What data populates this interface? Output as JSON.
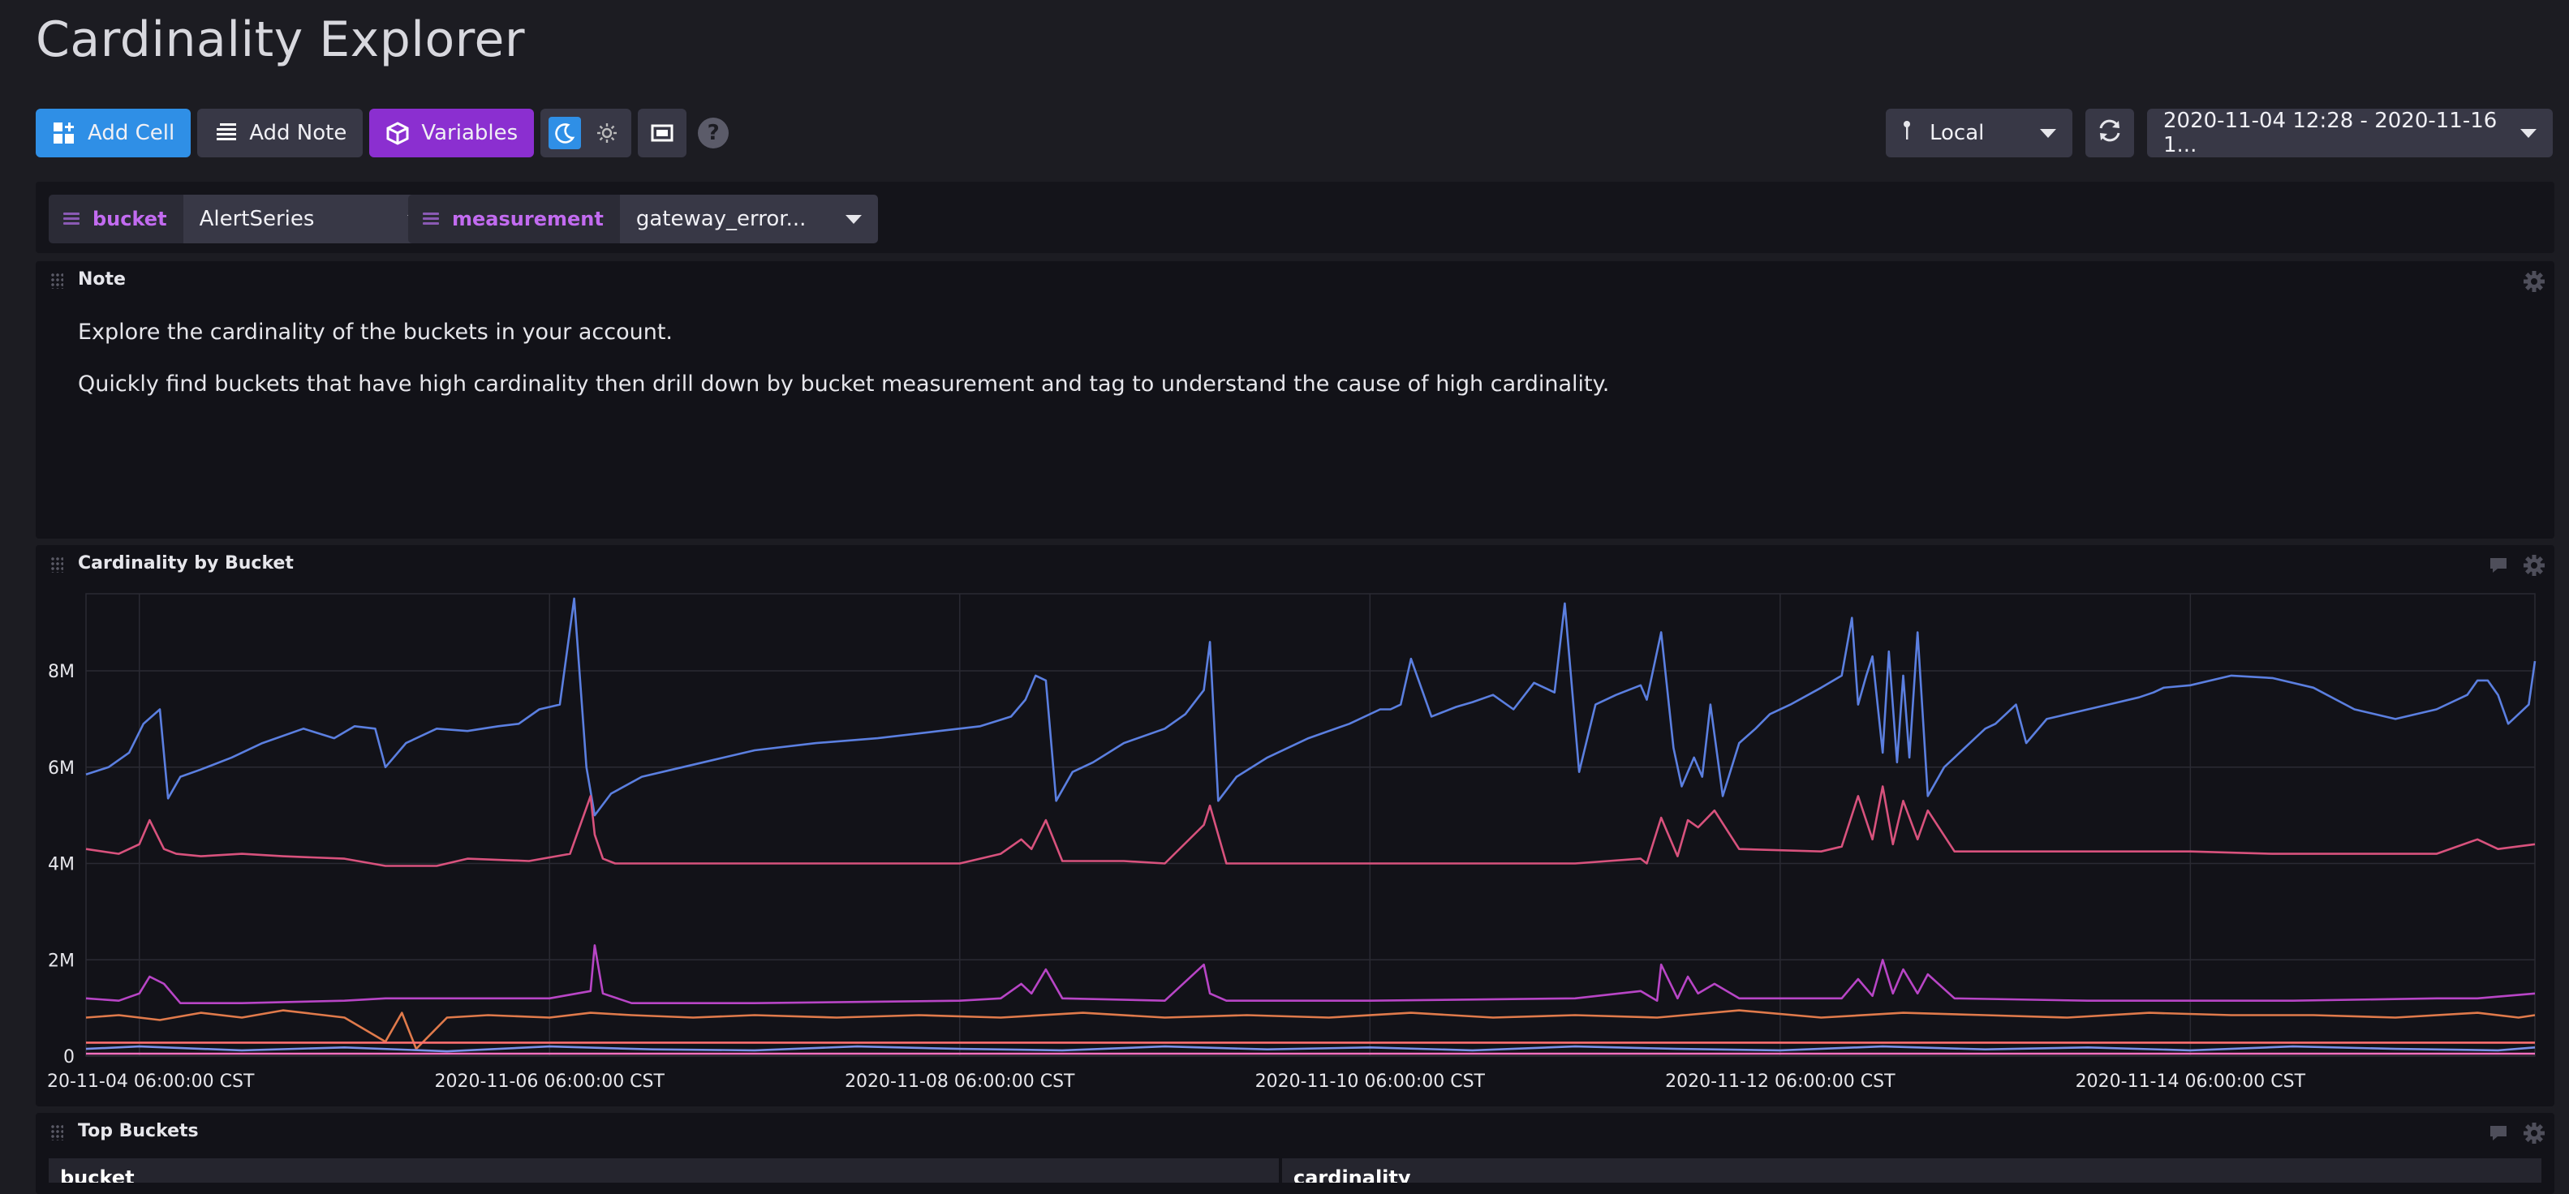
{
  "page_title": "Cardinality Explorer",
  "toolbar": {
    "add_cell": "Add Cell",
    "add_note": "Add Note",
    "variables": "Variables"
  },
  "timezone": "Local",
  "time_range": "2020-11-04 12:28 - 2020-11-16 1...",
  "variables": [
    {
      "name": "bucket",
      "value": "AlertSeries"
    },
    {
      "name": "measurement",
      "value": "gateway_error..."
    }
  ],
  "note_cell": {
    "title": "Note",
    "paragraphs": [
      "Explore the cardinality of the buckets in your account.",
      "Quickly find buckets that have high cardinality then drill down by bucket measurement and tag to understand the cause of high cardinality."
    ]
  },
  "chart_cell": {
    "title": "Cardinality by Bucket"
  },
  "top_buckets": {
    "title": "Top Buckets",
    "columns": [
      "bucket",
      "cardinality"
    ]
  },
  "colors": {
    "accent": "#2f8fe6",
    "variables_button": "#8b2fd0",
    "series_blue": "#5b7fe0",
    "series_pink": "#d8527d",
    "series_purple": "#b845c6",
    "series_orange": "#e07a4b",
    "series_coral": "#ff6f6f"
  },
  "chart_data": {
    "type": "line",
    "title": "",
    "xlabel": "",
    "ylabel": "",
    "x_ticks": [
      "20-11-04 06:00:00 CST",
      "2020-11-06 06:00:00 CST",
      "2020-11-08 06:00:00 CST",
      "2020-11-10 06:00:00 CST",
      "2020-11-12 06:00:00 CST",
      "2020-11-14 06:00:00 CST"
    ],
    "x_tick_dates": [
      3.0,
      5.0,
      7.0,
      9.0,
      11.0,
      13.0
    ],
    "y_ticks": [
      "0",
      "2M",
      "4M",
      "6M",
      "8M"
    ],
    "y_tick_values": [
      0,
      2,
      4,
      6,
      8
    ],
    "ylim": [
      0,
      9.6
    ],
    "xlim": [
      2.74,
      14.68
    ],
    "grid": true,
    "legend": "none",
    "series": [
      {
        "color": "#5b7fe0",
        "x": [
          2.74,
          2.85,
          2.95,
          3.02,
          3.1,
          3.14,
          3.2,
          3.3,
          3.45,
          3.6,
          3.8,
          3.95,
          4.05,
          4.15,
          4.2,
          4.3,
          4.45,
          4.6,
          4.75,
          4.85,
          4.95,
          5.05,
          5.12,
          5.18,
          5.22,
          5.3,
          5.45,
          5.6,
          5.8,
          6.0,
          6.3,
          6.6,
          6.9,
          7.1,
          7.25,
          7.32,
          7.37,
          7.42,
          7.47,
          7.55,
          7.65,
          7.8,
          8.0,
          8.1,
          8.19,
          8.22,
          8.26,
          8.35,
          8.5,
          8.7,
          8.9,
          9.05,
          9.1,
          9.15,
          9.2,
          9.3,
          9.42,
          9.5,
          9.6,
          9.7,
          9.8,
          9.9,
          9.95,
          10.02,
          10.1,
          10.2,
          10.32,
          10.35,
          10.42,
          10.48,
          10.52,
          10.58,
          10.62,
          10.66,
          10.72,
          10.8,
          10.88,
          10.95,
          11.05,
          11.2,
          11.3,
          11.35,
          11.38,
          11.42,
          11.45,
          11.5,
          11.53,
          11.57,
          11.6,
          11.63,
          11.67,
          11.72,
          11.8,
          11.85,
          11.9,
          11.95,
          12.0,
          12.05,
          12.1,
          12.15,
          12.2,
          12.3,
          12.45,
          12.6,
          12.75,
          12.82,
          12.87,
          13.0,
          13.2,
          13.4,
          13.6,
          13.8,
          14.0,
          14.2,
          14.35,
          14.4,
          14.45,
          14.5,
          14.55,
          14.6,
          14.65,
          14.68
        ],
        "y": [
          5.85,
          6.0,
          6.3,
          6.9,
          7.2,
          5.35,
          5.8,
          5.95,
          6.2,
          6.5,
          6.8,
          6.6,
          6.85,
          6.8,
          6.0,
          6.5,
          6.8,
          6.75,
          6.85,
          6.9,
          7.2,
          7.3,
          9.5,
          6.0,
          5.0,
          5.45,
          5.8,
          5.95,
          6.15,
          6.35,
          6.5,
          6.6,
          6.75,
          6.85,
          7.05,
          7.4,
          7.9,
          7.8,
          5.3,
          5.9,
          6.1,
          6.5,
          6.8,
          7.1,
          7.6,
          8.6,
          5.3,
          5.8,
          6.2,
          6.6,
          6.9,
          7.2,
          7.2,
          7.3,
          8.25,
          7.05,
          7.25,
          7.35,
          7.5,
          7.2,
          7.75,
          7.55,
          9.4,
          5.9,
          7.3,
          7.5,
          7.7,
          7.4,
          8.8,
          6.4,
          5.6,
          6.2,
          5.8,
          7.3,
          5.4,
          6.5,
          6.8,
          7.1,
          7.3,
          7.65,
          7.9,
          9.1,
          7.3,
          7.9,
          8.3,
          6.3,
          8.4,
          6.1,
          7.9,
          6.2,
          8.8,
          5.4,
          6.0,
          6.2,
          6.4,
          6.6,
          6.8,
          6.9,
          7.1,
          7.3,
          6.5,
          7.0,
          7.15,
          7.3,
          7.45,
          7.55,
          7.65,
          7.7,
          7.9,
          7.85,
          7.65,
          7.2,
          7.0,
          7.2,
          7.5,
          7.8,
          7.8,
          7.5,
          6.9,
          7.1,
          7.3,
          8.2
        ]
      },
      {
        "color": "#d8527d",
        "x": [
          2.74,
          2.9,
          3.0,
          3.05,
          3.12,
          3.18,
          3.3,
          3.5,
          3.7,
          4.0,
          4.2,
          4.3,
          4.45,
          4.6,
          4.9,
          5.1,
          5.2,
          5.22,
          5.26,
          5.32,
          5.45,
          5.8,
          6.5,
          7.0,
          7.2,
          7.3,
          7.35,
          7.42,
          7.5,
          7.8,
          8.0,
          8.19,
          8.22,
          8.3,
          8.5,
          9.0,
          9.1,
          9.3,
          9.5,
          10.0,
          10.32,
          10.35,
          10.42,
          10.5,
          10.55,
          10.6,
          10.68,
          10.8,
          11.2,
          11.3,
          11.38,
          11.45,
          11.5,
          11.55,
          11.6,
          11.67,
          11.72,
          11.85,
          12.2,
          12.6,
          13.0,
          13.4,
          13.8,
          14.2,
          14.4,
          14.5,
          14.68
        ],
        "y": [
          4.3,
          4.2,
          4.4,
          4.9,
          4.3,
          4.2,
          4.15,
          4.2,
          4.15,
          4.1,
          3.95,
          3.95,
          3.95,
          4.1,
          4.05,
          4.2,
          5.4,
          4.6,
          4.1,
          4.0,
          4.0,
          4.0,
          4.0,
          4.0,
          4.2,
          4.5,
          4.3,
          4.9,
          4.05,
          4.05,
          4.0,
          4.8,
          5.2,
          4.0,
          4.0,
          4.0,
          4.0,
          4.0,
          4.0,
          4.0,
          4.1,
          4.0,
          4.95,
          4.15,
          4.9,
          4.75,
          5.1,
          4.3,
          4.25,
          4.35,
          5.4,
          4.5,
          5.6,
          4.4,
          5.3,
          4.5,
          5.1,
          4.25,
          4.25,
          4.25,
          4.25,
          4.2,
          4.2,
          4.2,
          4.5,
          4.3,
          4.4
        ]
      },
      {
        "color": "#b845c6",
        "x": [
          2.74,
          2.9,
          3.0,
          3.05,
          3.12,
          3.2,
          3.5,
          4.0,
          4.2,
          4.5,
          5.0,
          5.2,
          5.22,
          5.26,
          5.4,
          6.0,
          7.0,
          7.2,
          7.3,
          7.35,
          7.42,
          7.5,
          8.0,
          8.19,
          8.22,
          8.3,
          9.0,
          10.0,
          10.32,
          10.4,
          10.42,
          10.5,
          10.55,
          10.6,
          10.68,
          10.8,
          11.3,
          11.38,
          11.45,
          11.5,
          11.55,
          11.6,
          11.67,
          11.72,
          11.85,
          12.5,
          13.5,
          14.2,
          14.4,
          14.68
        ],
        "y": [
          1.2,
          1.15,
          1.3,
          1.65,
          1.5,
          1.1,
          1.1,
          1.15,
          1.2,
          1.2,
          1.2,
          1.35,
          2.3,
          1.3,
          1.1,
          1.1,
          1.15,
          1.2,
          1.5,
          1.3,
          1.8,
          1.2,
          1.15,
          1.9,
          1.3,
          1.15,
          1.15,
          1.2,
          1.35,
          1.15,
          1.9,
          1.2,
          1.65,
          1.3,
          1.5,
          1.2,
          1.2,
          1.6,
          1.25,
          2.0,
          1.3,
          1.8,
          1.3,
          1.7,
          1.2,
          1.15,
          1.15,
          1.2,
          1.2,
          1.3
        ]
      },
      {
        "color": "#e07a4b",
        "x": [
          2.74,
          2.9,
          3.1,
          3.3,
          3.5,
          3.7,
          3.9,
          4.0,
          4.2,
          4.28,
          4.35,
          4.5,
          4.7,
          5.0,
          5.2,
          5.4,
          5.7,
          6.0,
          6.4,
          6.8,
          7.2,
          7.6,
          8.0,
          8.4,
          8.8,
          9.2,
          9.6,
          10.0,
          10.4,
          10.8,
          11.2,
          11.6,
          12.0,
          12.4,
          12.8,
          13.2,
          13.6,
          14.0,
          14.4,
          14.6,
          14.68
        ],
        "y": [
          0.8,
          0.85,
          0.75,
          0.9,
          0.8,
          0.95,
          0.85,
          0.8,
          0.3,
          0.9,
          0.15,
          0.8,
          0.85,
          0.8,
          0.9,
          0.85,
          0.8,
          0.85,
          0.8,
          0.85,
          0.8,
          0.9,
          0.8,
          0.85,
          0.8,
          0.9,
          0.8,
          0.85,
          0.8,
          0.95,
          0.8,
          0.9,
          0.85,
          0.8,
          0.9,
          0.85,
          0.85,
          0.8,
          0.9,
          0.8,
          0.85
        ]
      },
      {
        "color": "#7a8fe8",
        "x": [
          2.74,
          3.0,
          3.5,
          4.0,
          4.5,
          5.0,
          5.5,
          6.0,
          6.5,
          7.0,
          7.5,
          8.0,
          8.5,
          9.0,
          9.5,
          10.0,
          10.5,
          11.0,
          11.5,
          12.0,
          12.5,
          13.0,
          13.5,
          14.0,
          14.5,
          14.68
        ],
        "y": [
          0.15,
          0.2,
          0.12,
          0.18,
          0.1,
          0.2,
          0.14,
          0.12,
          0.2,
          0.15,
          0.12,
          0.2,
          0.14,
          0.18,
          0.12,
          0.2,
          0.15,
          0.12,
          0.2,
          0.14,
          0.18,
          0.12,
          0.2,
          0.15,
          0.12,
          0.18
        ]
      },
      {
        "color": "#ff6f6f",
        "x": [
          2.74,
          14.68
        ],
        "y": [
          0.28,
          0.28
        ]
      },
      {
        "color": "#f36fbd",
        "x": [
          2.74,
          14.68
        ],
        "y": [
          0.05,
          0.05
        ]
      }
    ]
  }
}
